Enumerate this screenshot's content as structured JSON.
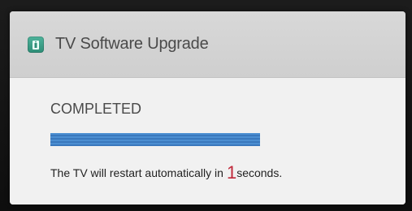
{
  "dialog": {
    "title": "TV Software Upgrade",
    "icon": "software-upgrade-icon",
    "status": "COMPLETED",
    "progress_fraction": 1.0,
    "restart_prefix": "The TV will restart automatically in",
    "countdown": "1",
    "restart_suffix": "seconds."
  },
  "colors": {
    "accent": "#3f82c7",
    "countdown": "#c0283a",
    "icon": "#3a9e86"
  }
}
